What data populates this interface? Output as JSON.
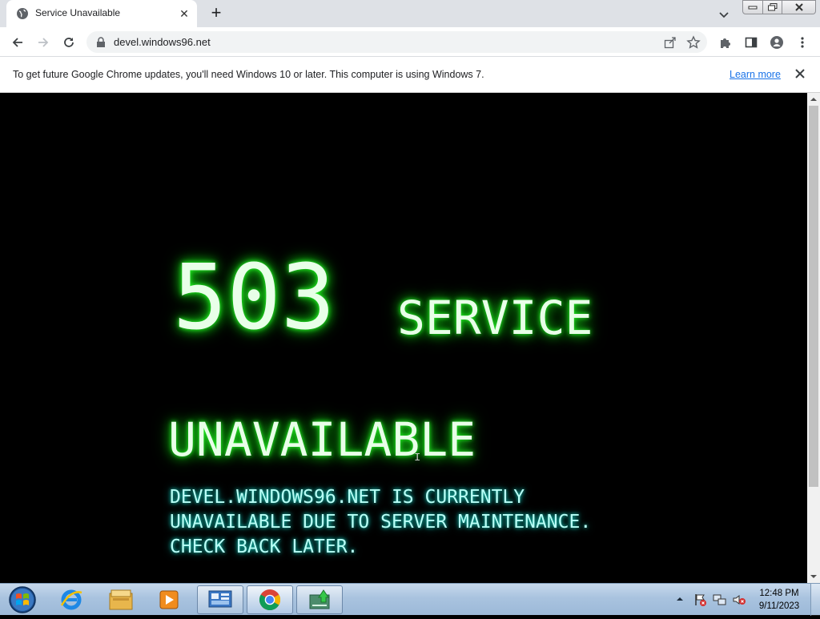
{
  "browser": {
    "tab": {
      "title": "Service Unavailable",
      "favicon": "globe-icon"
    },
    "url": "devel.windows96.net"
  },
  "infobar": {
    "message": "To get future Google Chrome updates, you'll need Windows 10 or later. This computer is using Windows 7.",
    "link": "Learn more"
  },
  "page": {
    "code": "503",
    "headline_1": "SERVICE",
    "headline_2": "UNAVAILABLE",
    "description": [
      "DEVEL.WINDOWS96.NET IS CURRENTLY",
      "UNAVAILABLE DUE TO SERVER MAINTENANCE.",
      "CHECK BACK LATER."
    ],
    "colors": {
      "background": "#000000",
      "headline": "#e8ffe8",
      "headline_glow": "#28ff28",
      "description": "#b8fff6",
      "description_glow": "#19d6c8"
    }
  },
  "taskbar": {
    "items": [
      "start-orb-icon",
      "internet-explorer-icon",
      "file-explorer-icon",
      "media-player-icon",
      "control-panel-icon",
      "chrome-icon",
      "download-app-icon"
    ],
    "clock": {
      "time": "12:48 PM",
      "date": "9/11/2023"
    }
  }
}
